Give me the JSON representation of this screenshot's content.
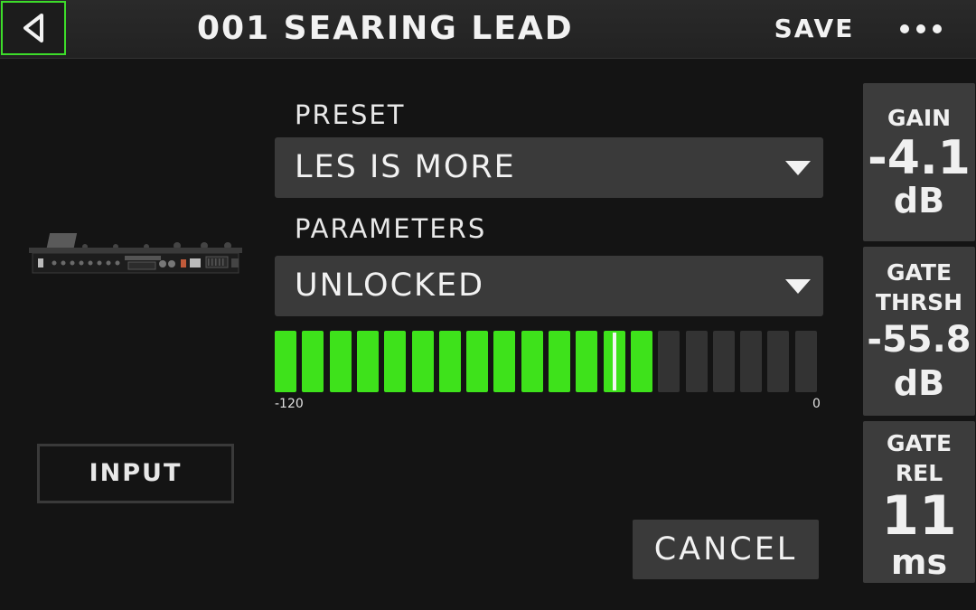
{
  "header": {
    "title": "001 SEARING LEAD",
    "save_label": "SAVE"
  },
  "preset": {
    "label": "PRESET",
    "value": "LES IS MORE"
  },
  "parameters": {
    "label": "PARAMETERS",
    "value": "UNLOCKED"
  },
  "meter": {
    "min_label": "-120",
    "max_label": "0",
    "total_segments": 20,
    "lit_segments": 14,
    "peak_segment": 12,
    "lit_color": "#3ee21b",
    "unlit_color": "#333333"
  },
  "input_label": "INPUT",
  "cancel_label": "CANCEL",
  "knobs": [
    {
      "label_lines": [
        "GAIN"
      ],
      "value": "-4.1",
      "unit": "dB"
    },
    {
      "label_lines": [
        "GATE",
        "THRSH"
      ],
      "value": "-55.8",
      "unit": "dB"
    },
    {
      "label_lines": [
        "GATE",
        "REL"
      ],
      "value": "11",
      "unit": "ms"
    }
  ],
  "icons": {
    "back": "back-arrow-icon",
    "more": "more-options-icon",
    "dropdown": "dropdown-caret-icon"
  },
  "colors": {
    "accent": "#3ddc2a",
    "background": "#141414",
    "control": "#3a3a3a"
  }
}
